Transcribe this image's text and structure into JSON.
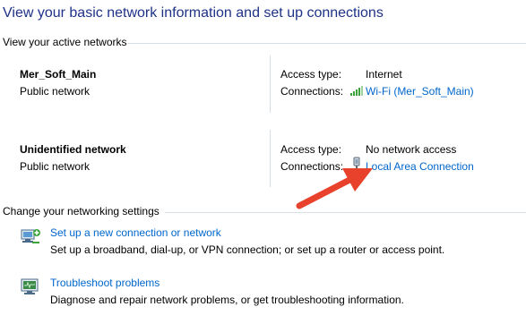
{
  "header": {
    "title": "View your basic network information and set up connections"
  },
  "active_networks": {
    "section_label": "View your active networks",
    "networks": [
      {
        "name": "Mer_Soft_Main",
        "category": "Public network",
        "access_type_label": "Access type:",
        "access_type_value": "Internet",
        "connections_label": "Connections:",
        "connection_name": "Wi-Fi (Mer_Soft_Main)",
        "connection_icon": "wifi-signal-icon"
      },
      {
        "name": "Unidentified network",
        "category": "Public network",
        "access_type_label": "Access type:",
        "access_type_value": "No network access",
        "connections_label": "Connections:",
        "connection_name": "Local Area Connection",
        "connection_icon": "ethernet-plug-icon"
      }
    ]
  },
  "networking_settings": {
    "section_label": "Change your networking settings",
    "tasks": [
      {
        "link": "Set up a new connection or network",
        "description": "Set up a broadband, dial-up, or VPN connection; or set up a router or access point.",
        "icon": "new-connection-icon"
      },
      {
        "link": "Troubleshoot problems",
        "description": "Diagnose and repair network problems, or get troubleshooting information.",
        "icon": "troubleshoot-icon"
      }
    ]
  },
  "colors": {
    "title": "#1e3287",
    "link": "#0066cc",
    "divider": "#d5dfe5",
    "annotation_arrow": "#e8412c"
  }
}
